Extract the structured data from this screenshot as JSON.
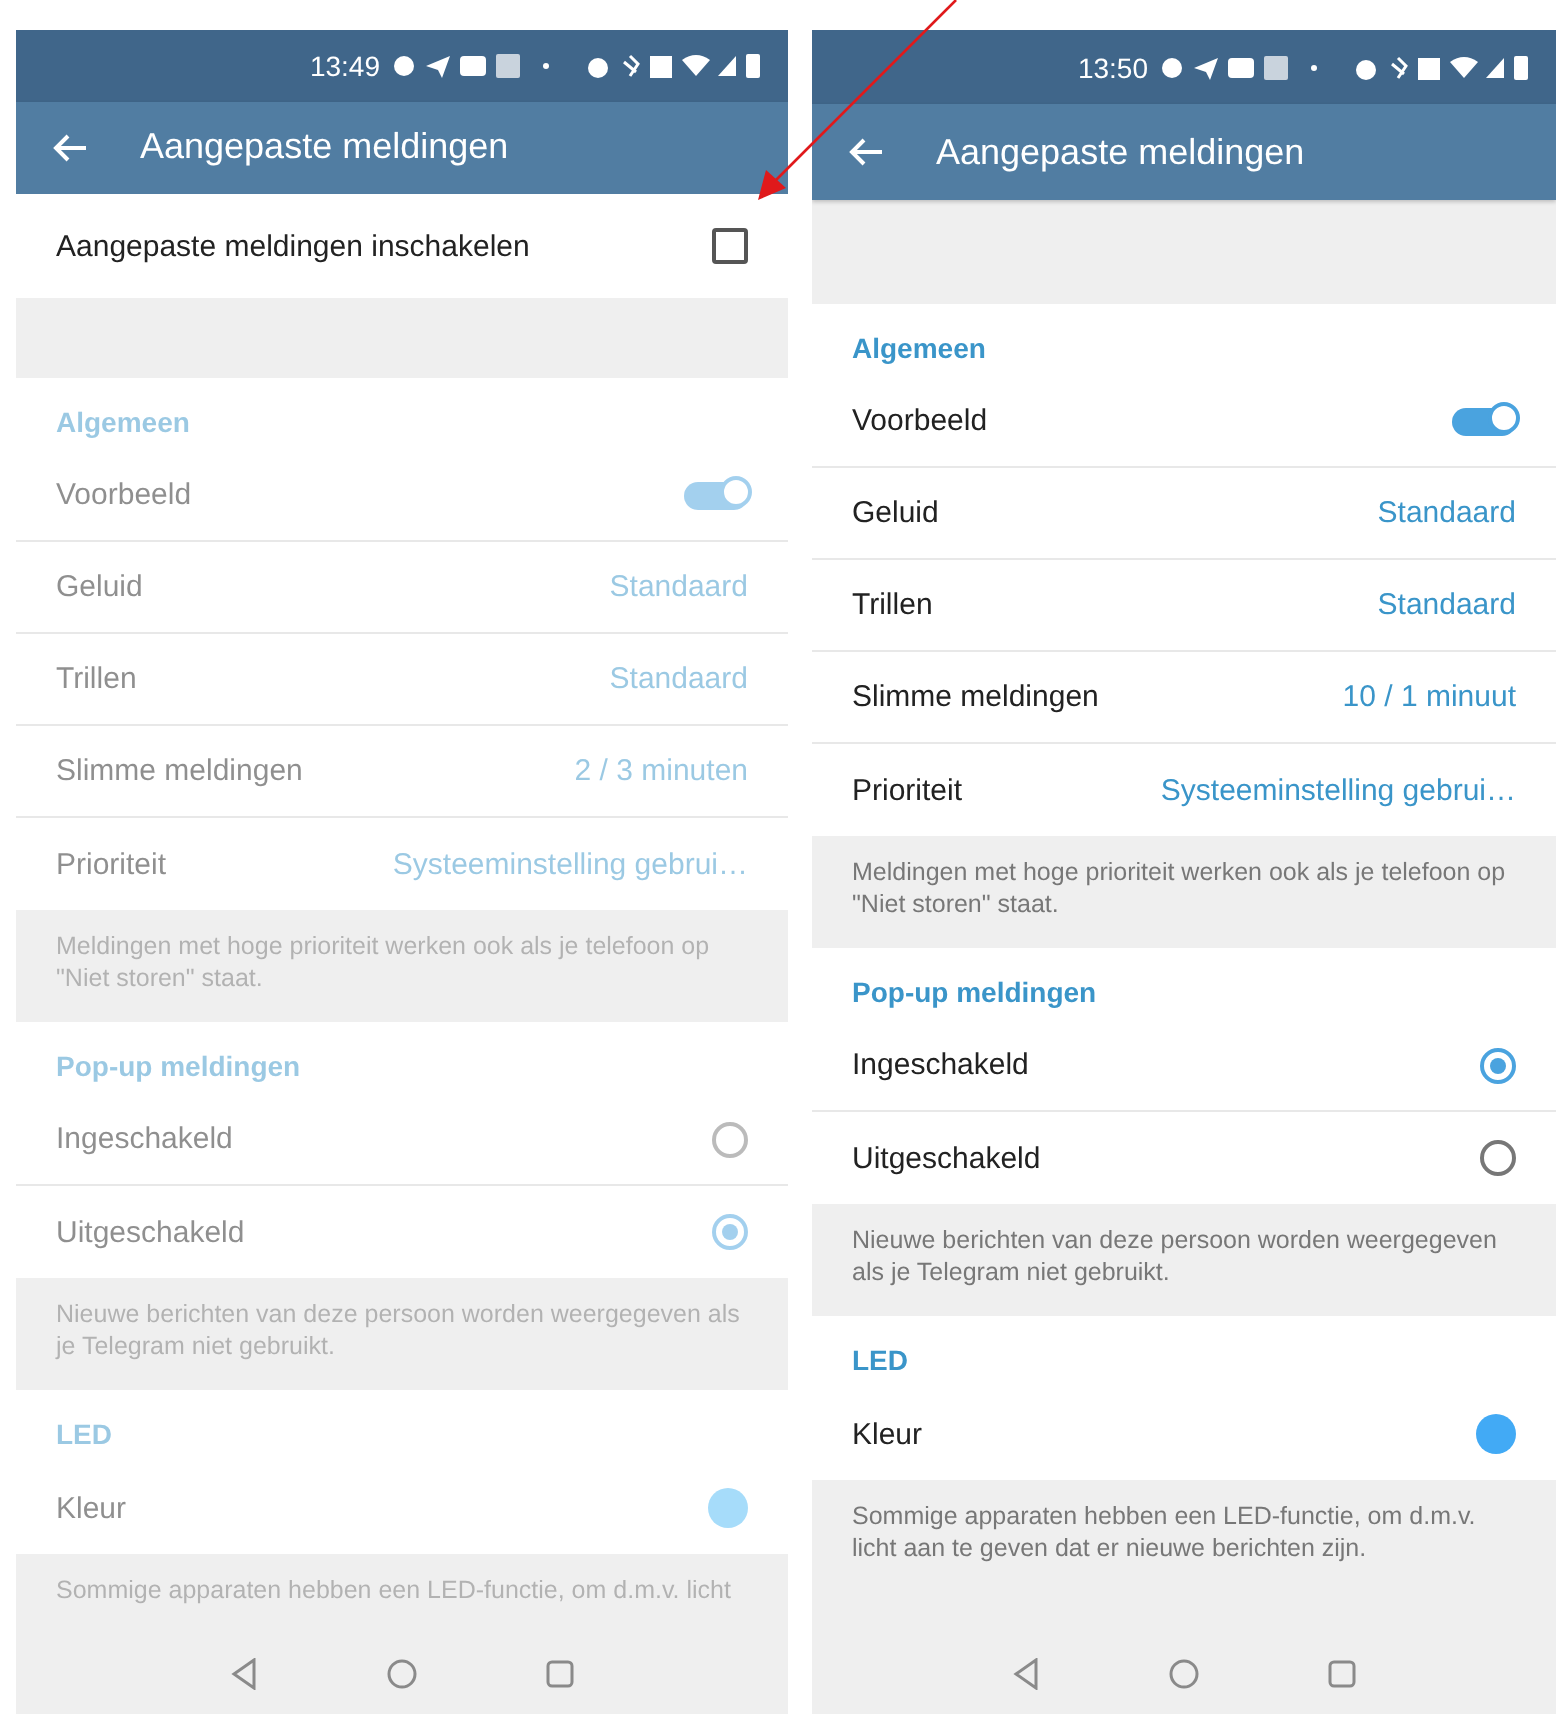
{
  "phones": [
    {
      "time": "13:49",
      "title": "Aangepaste meldingen",
      "disabled": true,
      "enable_row": {
        "label": "Aangepaste meldingen inschakelen",
        "checked": false
      },
      "sections": [
        {
          "header": "Algemeen",
          "items": [
            {
              "kind": "toggle",
              "label": "Voorbeeld",
              "on": true
            },
            {
              "kind": "value",
              "label": "Geluid",
              "value": "Standaard"
            },
            {
              "kind": "value",
              "label": "Trillen",
              "value": "Standaard"
            },
            {
              "kind": "value",
              "label": "Slimme meldingen",
              "value": "2 / 3 minuten"
            },
            {
              "kind": "value",
              "label": "Prioriteit",
              "value": "Systeeminstelling gebrui…"
            }
          ],
          "note": "Meldingen met hoge prioriteit werken ook als je telefoon op \"Niet storen\" staat."
        },
        {
          "header": "Pop-up meldingen",
          "items": [
            {
              "kind": "radio",
              "label": "Ingeschakeld",
              "selected": false
            },
            {
              "kind": "radio",
              "label": "Uitgeschakeld",
              "selected": true
            }
          ],
          "note": "Nieuwe berichten van deze persoon worden weergegeven als je Telegram niet gebruikt."
        },
        {
          "header": "LED",
          "items": [
            {
              "kind": "color",
              "label": "Kleur",
              "color": "#a6dcfa"
            }
          ],
          "note": "Sommige apparaten hebben een LED-functie, om d.m.v. licht"
        }
      ]
    },
    {
      "time": "13:50",
      "title": "Aangepaste meldingen",
      "disabled": false,
      "sections": [
        {
          "header": "Algemeen",
          "items": [
            {
              "kind": "toggle",
              "label": "Voorbeeld",
              "on": true
            },
            {
              "kind": "value",
              "label": "Geluid",
              "value": "Standaard"
            },
            {
              "kind": "value",
              "label": "Trillen",
              "value": "Standaard"
            },
            {
              "kind": "value",
              "label": "Slimme meldingen",
              "value": "10 / 1 minuut"
            },
            {
              "kind": "value",
              "label": "Prioriteit",
              "value": "Systeeminstelling gebrui…"
            }
          ],
          "note": "Meldingen met hoge prioriteit werken ook als je telefoon op \"Niet storen\" staat."
        },
        {
          "header": "Pop-up meldingen",
          "items": [
            {
              "kind": "radio",
              "label": "Ingeschakeld",
              "selected": true
            },
            {
              "kind": "radio",
              "label": "Uitgeschakeld",
              "selected": false
            }
          ],
          "note": "Nieuwe berichten van deze persoon worden weergegeven als je Telegram niet gebruikt."
        },
        {
          "header": "LED",
          "items": [
            {
              "kind": "color",
              "label": "Kleur",
              "color": "#42aaf5"
            }
          ],
          "note": "Sommige apparaten hebben een LED-functie, om d.m.v. licht aan te geven dat er nieuwe berichten zijn."
        }
      ]
    }
  ]
}
